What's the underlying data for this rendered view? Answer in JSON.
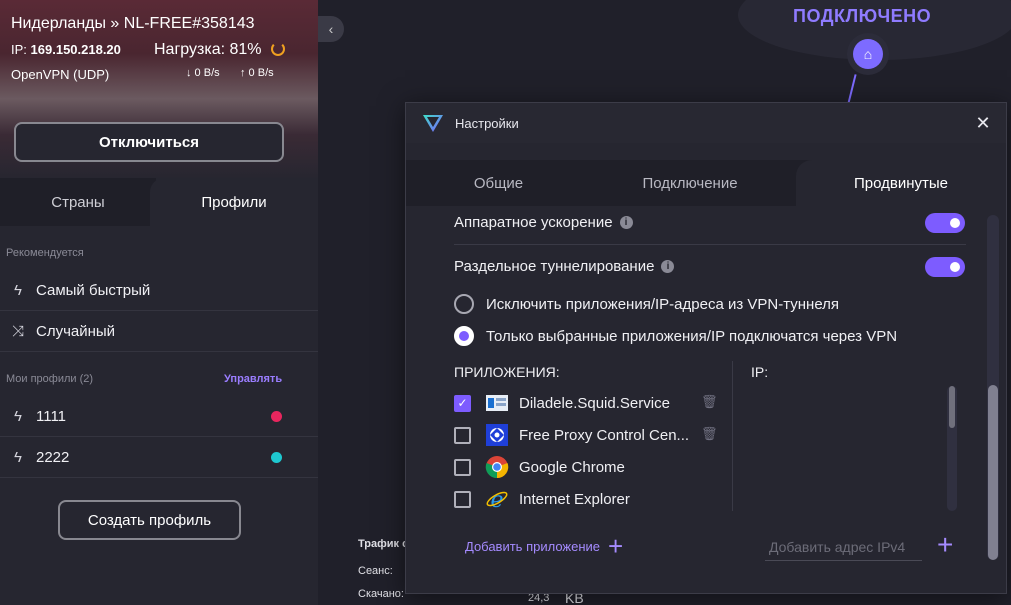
{
  "connection": {
    "server": "Нидерланды » NL-FREE#358143",
    "ip_label": "IP:",
    "ip_value": "169.150.218.20",
    "load": "Нагрузка: 81%",
    "protocol": "OpenVPN (UDP)",
    "download": "↓ 0 B/s",
    "upload": "↑ 0 B/s",
    "disconnect_label": "Отключиться",
    "status": "ПОДКЛЮЧЕНО"
  },
  "sidebar": {
    "tabs": [
      "Страны",
      "Профили"
    ],
    "recommended_label": "Рекомендуется",
    "recommended": [
      {
        "label": "Самый быстрый",
        "icon": "lightning-icon"
      },
      {
        "label": "Случайный",
        "icon": "shuffle-icon"
      }
    ],
    "my_profiles_label": "Мои профили (2)",
    "manage_label": "Управлять",
    "profiles": [
      {
        "label": "1111",
        "color": "#e8265e"
      },
      {
        "label": "2222",
        "color": "#1ec8d0"
      }
    ],
    "create_label": "Создать профиль"
  },
  "stats": {
    "title": "Трафик с",
    "session": "Сеанс:",
    "downloaded": "Скачано:",
    "value": "24,3",
    "unit": "KB"
  },
  "dialog": {
    "title": "Настройки",
    "tabs": [
      "Общие",
      "Подключение",
      "Продвинутые"
    ],
    "active_tab": "Продвинутые",
    "hardware_accel": {
      "label": "Аппаратное ускорение",
      "enabled": true
    },
    "split_tunnel": {
      "label": "Раздельное туннелирование",
      "enabled": true
    },
    "radio_exclude": "Исключить приложения/IP-адреса из VPN-туннеля",
    "radio_include": "Только выбранные приложения/IP подключатся через VPN",
    "apps_header": "ПРИЛОЖЕНИЯ:",
    "ip_header": "IP:",
    "apps": [
      {
        "name": "Diladele.Squid.Service",
        "checked": true
      },
      {
        "name": "Free Proxy Control Cen...",
        "checked": false
      },
      {
        "name": "Google Chrome",
        "checked": false
      },
      {
        "name": "Internet Explorer",
        "checked": false
      }
    ],
    "add_app_label": "Добавить приложение",
    "ip_placeholder": "Добавить адрес IPv4"
  },
  "colors": {
    "accent": "#7d5cff",
    "status": "#8f7bff"
  }
}
